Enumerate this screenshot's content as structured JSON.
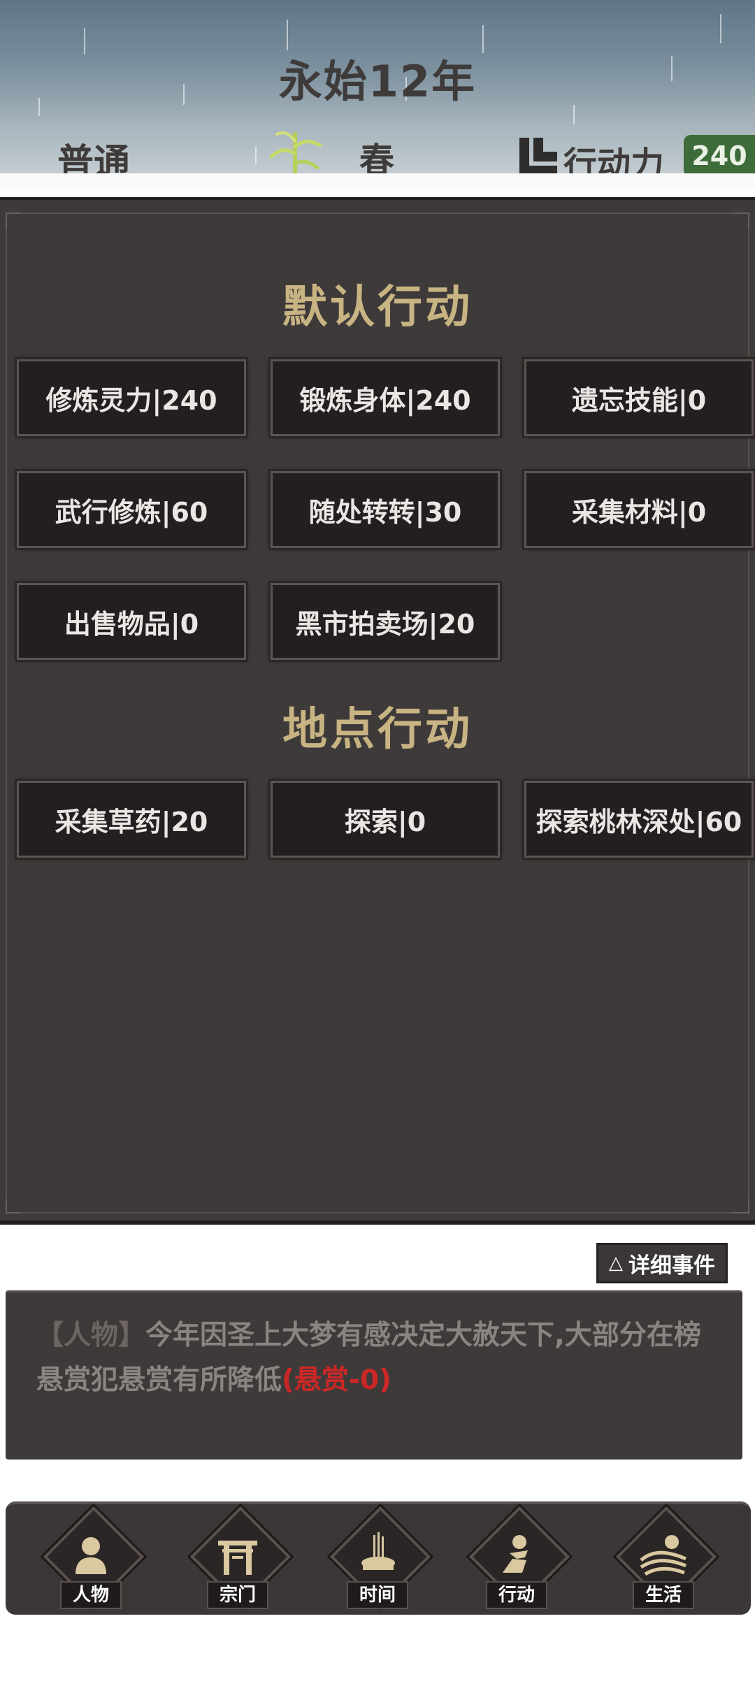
{
  "header": {
    "year": "永始12年",
    "difficulty": "普通",
    "season": "春",
    "action_points_label": "行动力",
    "action_points_value": "240"
  },
  "default_actions": {
    "title": "默认行动",
    "buttons": [
      {
        "label": "修炼灵力|240"
      },
      {
        "label": "锻炼身体|240"
      },
      {
        "label": "遗忘技能|0"
      },
      {
        "label": "武行修炼|60"
      },
      {
        "label": "随处转转|30"
      },
      {
        "label": "采集材料|0"
      },
      {
        "label": "出售物品|0"
      },
      {
        "label": "黑市拍卖场|20"
      }
    ]
  },
  "location_actions": {
    "title": "地点行动",
    "buttons": [
      {
        "label": "采集草药|20"
      },
      {
        "label": "探索|0"
      },
      {
        "label": "探索桃林深处|60"
      }
    ]
  },
  "events": {
    "detail_button": "详细事件",
    "detail_icon": "△",
    "entry_tag": "【人物】",
    "entry_text": "今年因圣上大梦有感决定大赦天下,大部分在榜悬赏犯悬赏有所降低",
    "entry_highlight": "(悬赏-0)"
  },
  "nav": {
    "items": [
      {
        "label": "人物",
        "icon": "person-icon"
      },
      {
        "label": "宗门",
        "icon": "gate-icon"
      },
      {
        "label": "时间",
        "icon": "incense-icon"
      },
      {
        "label": "行动",
        "icon": "action-icon"
      },
      {
        "label": "生活",
        "icon": "landscape-icon"
      }
    ]
  },
  "colors": {
    "accent_gold": "#c8b483",
    "panel": "#3e3a3a",
    "button": "#231f20",
    "ap_badge": "#3d6b3a",
    "highlight_red": "#cc2727"
  }
}
